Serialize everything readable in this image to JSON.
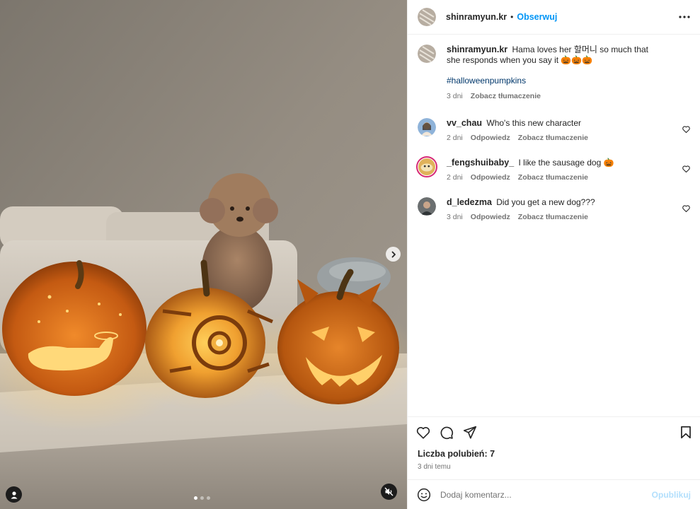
{
  "post": {
    "author": "shinramyun.kr",
    "separator": "•",
    "follow_label": "Obserwuj",
    "caption_text": "Hama loves her 할머니 so much that she responds when you say it 🎃🎃🎃",
    "hashtag": "#halloweenpumpkins",
    "caption_time": "3 dni",
    "caption_translate": "Zobacz tłumaczenie",
    "likes_label": "Liczba polubień: 7",
    "posted_ago": "3 dni temu"
  },
  "comments": [
    {
      "user": "vv_chau",
      "text": "Who's this new character",
      "time": "2 dni",
      "reply": "Odpowiedz",
      "translate": "Zobacz tłumaczenie",
      "avatar_color": "#8fb3d9"
    },
    {
      "user": "_fengshuibaby_",
      "text": "I like the sausage dog 🎃",
      "time": "2 dni",
      "reply": "Odpowiedz",
      "translate": "Zobacz tłumaczenie",
      "avatar_color": "#e0b25a"
    },
    {
      "user": "d_ledezma",
      "text": "Did you get a new dog???",
      "time": "3 dni",
      "reply": "Odpowiedz",
      "translate": "Zobacz tłumaczenie",
      "avatar_color": "#6b6f70"
    }
  ],
  "add_comment": {
    "placeholder": "Dodaj komentarz...",
    "publish_label": "Opublikuj"
  },
  "icons": {
    "more": "more-horizontal-icon",
    "like": "heart-icon",
    "comment": "comment-bubble-icon",
    "share": "paper-plane-icon",
    "save": "bookmark-icon",
    "emoji": "smiley-icon",
    "next": "chevron-right-icon",
    "tags": "user-tag-icon",
    "mute": "speaker-muted-icon"
  },
  "carousel": {
    "total": 3,
    "active": 0
  },
  "colors": {
    "accent": "#0095f6",
    "link": "#00376b",
    "publish_disabled": "#b2dffc"
  }
}
